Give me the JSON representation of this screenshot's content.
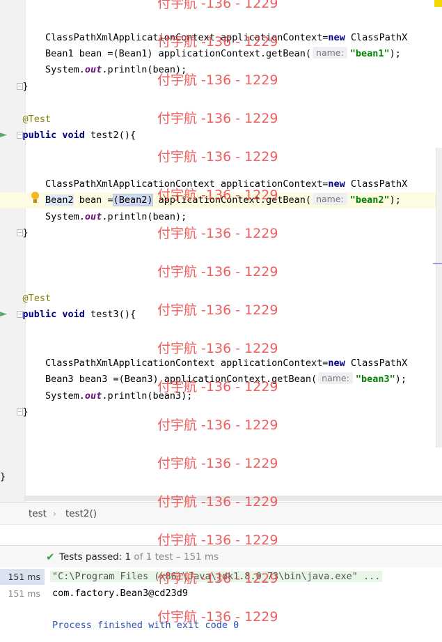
{
  "editor": {
    "lines": [
      {
        "text": "        ClassPathXmlApplicationContext applicationContext=new ClassPathX",
        "parts": [
          [
            "        ClassPathXmlApplicationContext applicationContext=",
            ""
          ],
          [
            "new",
            "kw"
          ],
          [
            " ClassPathX",
            ""
          ]
        ]
      },
      {
        "parts": [
          [
            "        Bean1 bean =(Bean1) applicationContext.getBean(",
            ""
          ],
          [
            "name:",
            "hint"
          ],
          [
            "\"bean1\"",
            "str"
          ],
          [
            ");",
            ""
          ]
        ]
      },
      {
        "parts": [
          [
            "        System.",
            ""
          ],
          [
            "out",
            "fld"
          ],
          [
            ".println(bean);",
            ""
          ]
        ]
      },
      {
        "parts": [
          [
            "    }",
            ""
          ]
        ]
      },
      {
        "parts": [
          [
            "    ",
            ""
          ],
          [
            "@Test",
            "ann"
          ]
        ]
      },
      {
        "parts": [
          [
            "    ",
            ""
          ],
          [
            "public void",
            "kw"
          ],
          [
            " test2(){",
            ""
          ]
        ]
      },
      {
        "parts": [
          [
            "        ClassPathXmlApplicationContext applicationContext=",
            ""
          ],
          [
            "new",
            "kw"
          ],
          [
            " ClassPathX",
            ""
          ]
        ]
      },
      {
        "parts": [
          [
            "        ",
            ""
          ],
          [
            "Bean2",
            "hl"
          ],
          [
            " bean =",
            ""
          ],
          [
            "(Bean2)",
            "brace-hl"
          ],
          [
            " applicationContext.getBean(",
            ""
          ],
          [
            "name:",
            "hint"
          ],
          [
            "\"bean2\"",
            "str"
          ],
          [
            ");",
            ""
          ]
        ]
      },
      {
        "parts": [
          [
            "        System.",
            ""
          ],
          [
            "out",
            "fld"
          ],
          [
            ".println(bean);",
            ""
          ]
        ]
      },
      {
        "parts": [
          [
            "    }",
            ""
          ]
        ]
      },
      {
        "parts": [
          [
            "    ",
            ""
          ],
          [
            "@Test",
            "ann"
          ]
        ]
      },
      {
        "parts": [
          [
            "    ",
            ""
          ],
          [
            "public void",
            "kw"
          ],
          [
            " test3(){",
            ""
          ]
        ]
      },
      {
        "parts": [
          [
            "        ClassPathXmlApplicationContext applicationContext=",
            ""
          ],
          [
            "new",
            "kw"
          ],
          [
            " ClassPathX",
            ""
          ]
        ]
      },
      {
        "parts": [
          [
            "        Bean3 bean3 =(Bean3) applicationContext.getBean(",
            ""
          ],
          [
            "name:",
            "hint"
          ],
          [
            "\"bean3\"",
            "str"
          ],
          [
            ");",
            ""
          ]
        ]
      },
      {
        "parts": [
          [
            "        System.",
            ""
          ],
          [
            "out",
            "fld"
          ],
          [
            ".println(bean3);",
            ""
          ]
        ]
      },
      {
        "parts": [
          [
            "    }",
            ""
          ]
        ]
      },
      {
        "parts": [
          [
            "}",
            ""
          ]
        ]
      }
    ]
  },
  "breadcrumb": {
    "items": [
      "test",
      "test2()"
    ]
  },
  "test_status": {
    "label": "Tests passed: ",
    "passed": "1",
    "total": " of 1 test – 151 ms"
  },
  "console": {
    "times": [
      "151 ms",
      "151 ms"
    ],
    "lines": [
      "\"C:\\Program Files (x86)\\Java\\jdk1.8.0_73\\bin\\java.exe\" ...",
      "com.factory.Bean3@cd23d9",
      "Process finished with exit code 0"
    ]
  },
  "watermark": "付宇航 -136 - 1229",
  "icons": {
    "run": "run-test-icon",
    "bulb": "intention-bulb-icon",
    "check": "check-icon"
  },
  "colors": {
    "keyword": "#000080",
    "annotation": "#808000",
    "string": "#008000",
    "watermark": "#ec4c4c"
  }
}
